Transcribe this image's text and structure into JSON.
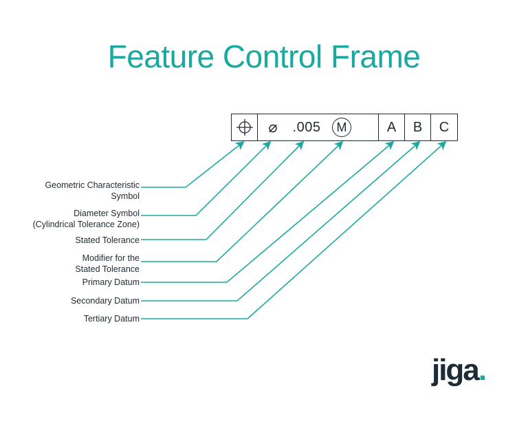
{
  "title": "Feature Control Frame",
  "accent_color": "#18a9a1",
  "line_color": "#1aa9a1",
  "frame": {
    "geom_symbol": "⊕",
    "diameter_symbol": "⌀",
    "tolerance_value": ".005",
    "modifier_letter": "M",
    "datum_primary": "A",
    "datum_secondary": "B",
    "datum_tertiary": "C"
  },
  "labels": {
    "geom": "Geometric Characteristic\nSymbol",
    "dia": "Diameter Symbol\n(Cylindrical Tolerance Zone)",
    "tol": "Stated Tolerance",
    "mod": "Modifier for the\nStated Tolerance",
    "da": "Primary Datum",
    "db": "Secondary Datum",
    "dc": "Tertiary Datum"
  },
  "logo": {
    "text": "jiga",
    "dot": "."
  }
}
